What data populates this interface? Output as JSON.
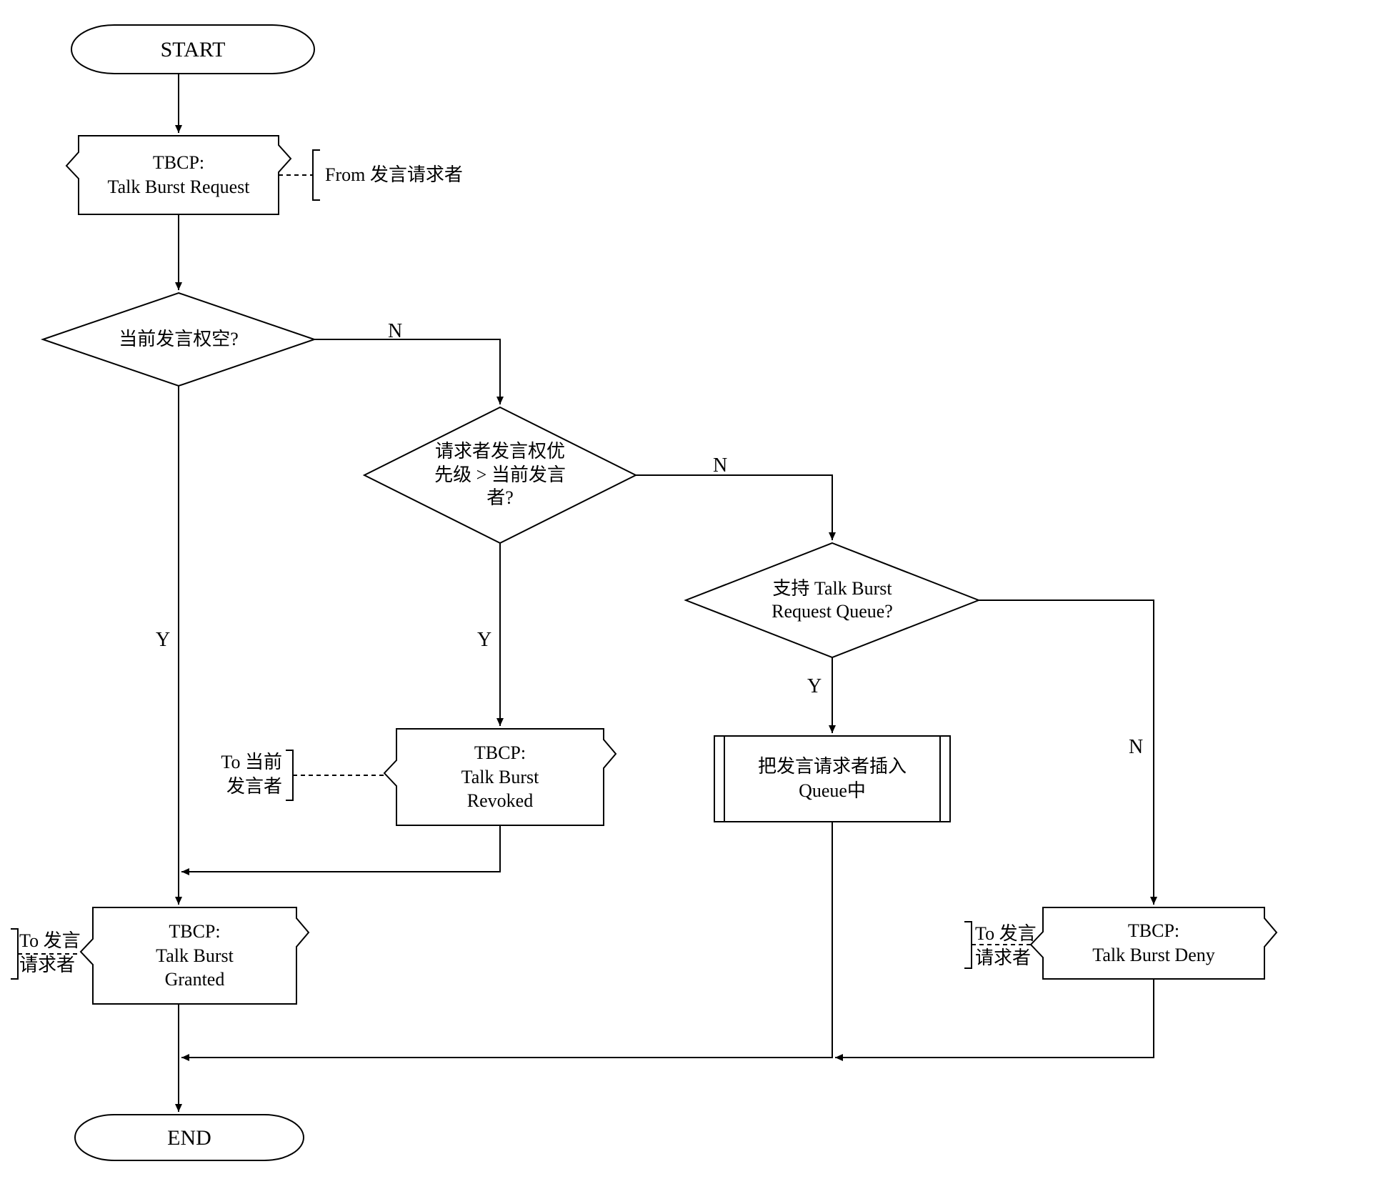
{
  "nodes": {
    "start": "START",
    "end": "END",
    "tbcp_request": {
      "line1": "TBCP:",
      "line2": "Talk Burst Request"
    },
    "tbcp_revoked": {
      "line1": "TBCP:",
      "line2": "Talk Burst",
      "line3": "Revoked"
    },
    "tbcp_granted": {
      "line1": "TBCP:",
      "line2": "Talk Burst",
      "line3": "Granted"
    },
    "tbcp_deny": {
      "line1": "TBCP:",
      "line2": "Talk Burst Deny"
    },
    "dec_floor_empty": "当前发言权空?",
    "dec_priority": {
      "line1": "请求者发言权优",
      "line2": "先级 > 当前发言",
      "line3": "者?"
    },
    "dec_queue": {
      "line1": "支持 Talk Burst",
      "line2": "Request Queue?"
    },
    "proc_insert_queue": {
      "line1": "把发言请求者插入",
      "line2": "Queue中"
    }
  },
  "comments": {
    "from_requester": "From 发言请求者",
    "to_current": {
      "line1": "To 当前",
      "line2": "发言者"
    },
    "to_requester1": {
      "line1": "To 发言",
      "line2": "请求者"
    },
    "to_requester2": {
      "line1": "To 发言",
      "line2": "请求者"
    }
  },
  "edge_labels": {
    "y": "Y",
    "n": "N"
  }
}
